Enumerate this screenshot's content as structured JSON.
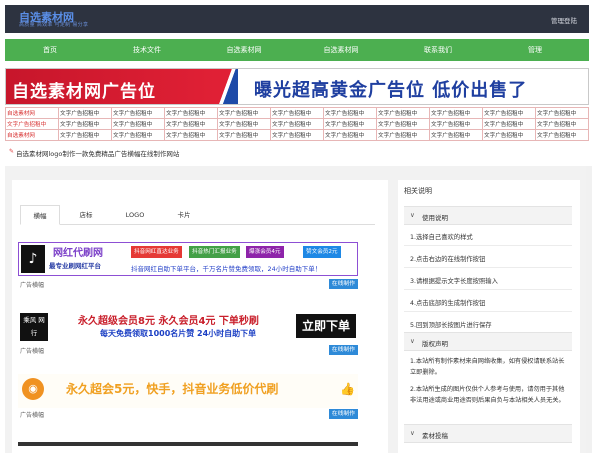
{
  "header": {
    "logo": "自选素材网",
    "logo_sub": "高质量 高效率 可定制 易分享",
    "admin_link": "管理登陆"
  },
  "nav": {
    "items": [
      "首页",
      "技术文件",
      "自选素材网",
      "自选素材网",
      "联系我们",
      "管理"
    ]
  },
  "banner": {
    "left_text": "自选素材网广告位",
    "right_text": "曝光超高黄金广告位 低价出售了"
  },
  "links_grid": {
    "first_col": [
      "自选素材网",
      "文字广告招租中",
      "自选素材网"
    ],
    "cell_text": "文字广告招租中"
  },
  "notice": "自选素材网logo制作一款免费精品广告横幅在线制作网站",
  "tabs": [
    "横幅",
    "店标",
    "LOGO",
    "卡片"
  ],
  "ads": [
    {
      "label": "广告横幅",
      "action": "在线制作",
      "title": "网红代刷网",
      "subtitle": "最专业刷网红平台",
      "pills": [
        "抖音网红直达业务",
        "抖音热门汇报业务",
        "爆涨会员4元",
        "赞文会员2元"
      ],
      "pill_colors": [
        "#e53935",
        "#43a047",
        "#8e24aa",
        "#1e88e5"
      ],
      "marquee": "抖音网红自助下单平台，千万名片赞免费领取，24小时自助下单！"
    },
    {
      "label": "广告横幅",
      "action": "在线制作",
      "logo_text": "乘风 网行",
      "line1": "永久超级会员8元  永久会员4元  下单秒刷",
      "line2": "每天免费领取1000名片赞  24小时自助下单",
      "button": "立即下单"
    },
    {
      "label": "广告横幅",
      "action": "在线制作",
      "text": "永久超会5元，快手，抖音业务低价代刷"
    }
  ],
  "sidebar": {
    "title": "相关说明",
    "sections": [
      {
        "label": "使用说明",
        "items": [
          "1.选择自己喜欢的样式",
          "2.点击右边的在线制作按钮",
          "3.请根据提示文字长度按照输入",
          "4.点击底部的生成制作按钮",
          "5.回到顶部长按图片进行保存"
        ]
      },
      {
        "label": "版权声明",
        "paragraphs": [
          "1.本站所有制作素材来自网络收集，如有侵权请联系站长立即删除。",
          "2.本站所生成的图片仅供个人参考与使用，请勿用于其他非法用途或商业用途否则后果自负与本站相关人员无关。"
        ]
      },
      {
        "label": "素材投稿"
      }
    ]
  },
  "colors": {
    "topbar": "#2d3340",
    "nav": "#4caf50",
    "action": "#2e8ad8",
    "accent_red": "#d62d2d"
  }
}
